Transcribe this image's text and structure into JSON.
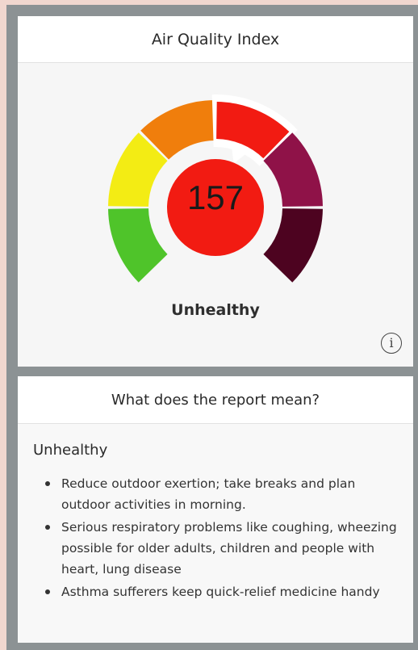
{
  "card": {
    "title": "Air Quality Index",
    "aqi_value": "157",
    "status": "Unhealthy",
    "info_glyph": "i",
    "segments": [
      {
        "level": "good",
        "color": "#4fc42a"
      },
      {
        "level": "moderate",
        "color": "#f3ec14"
      },
      {
        "level": "unhealthy-sensitive",
        "color": "#f07e0c"
      },
      {
        "level": "unhealthy",
        "color": "#f21b12",
        "active": true
      },
      {
        "level": "very-unhealthy",
        "color": "#8f1248"
      },
      {
        "level": "hazardous",
        "color": "#4d0320"
      }
    ]
  },
  "report": {
    "title": "What does the report mean?",
    "level": "Unhealthy",
    "bullets": [
      "Reduce outdoor exertion; take breaks and plan outdoor activities in morning.",
      "Serious respiratory problems like coughing, wheezing possible for older adults, children and people with heart, lung disease",
      "Asthma sufferers keep quick-relief medicine handy"
    ]
  },
  "colors": {
    "center_circle": "#f21b12",
    "page_background": "#f1d7cf",
    "frame": "#8c9294"
  }
}
